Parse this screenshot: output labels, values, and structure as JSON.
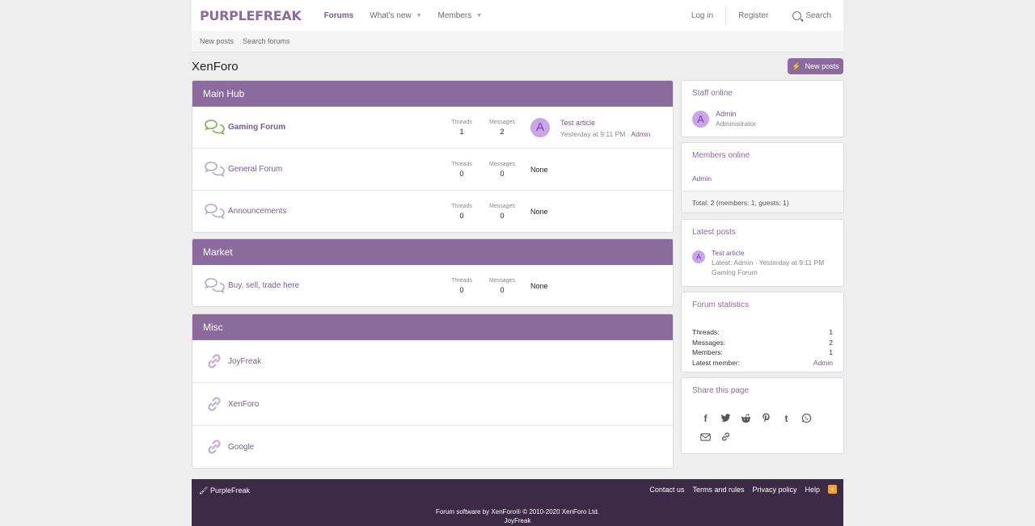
{
  "header": {
    "logo": "PURPLEFREAK",
    "nav": [
      {
        "label": "Forums",
        "active": true
      },
      {
        "label": "What's new",
        "caret": true
      },
      {
        "label": "Members",
        "caret": true
      }
    ],
    "login": "Log in",
    "register": "Register",
    "search": "Search"
  },
  "subnav": {
    "new_posts": "New posts",
    "search_forums": "Search forums"
  },
  "page": {
    "title": "XenForo",
    "new_posts_button": "New posts"
  },
  "categories": [
    {
      "title": "Main Hub",
      "nodes": [
        {
          "title": "Gaming Forum",
          "threads": "1",
          "messages": "2",
          "last_title": "Test article",
          "last_meta": "Yesterday at 9:11 PM · ",
          "last_user": "Admin",
          "avatar": "A"
        },
        {
          "title": "General Forum",
          "threads": "0",
          "messages": "0",
          "none": "None"
        },
        {
          "title": "Announcements",
          "threads": "0",
          "messages": "0",
          "none": "None"
        }
      ]
    },
    {
      "title": "Market",
      "nodes": [
        {
          "title": "Buy, sell, trade here",
          "threads": "0",
          "messages": "0",
          "none": "None"
        }
      ]
    },
    {
      "title": "Misc",
      "links": [
        "JoyFreak",
        "XenForo",
        "Google"
      ]
    }
  ],
  "labels": {
    "threads": "Threads",
    "messages": "Messages"
  },
  "sidebar": {
    "staff": {
      "title": "Staff online",
      "name": "Admin",
      "role": "Administrator",
      "avatar": "A"
    },
    "members": {
      "title": "Members online",
      "user": "Admin",
      "total": "Total: 2 (members: 1, guests: 1)"
    },
    "latest": {
      "title": "Latest posts",
      "post": "Test article",
      "meta": "Latest: Admin · Yesterday at 9:11 PM",
      "forum": "Gaming Forum",
      "avatar": "A"
    },
    "stats": {
      "title": "Forum statistics",
      "rows": [
        {
          "label": "Threads:",
          "value": "1"
        },
        {
          "label": "Messages:",
          "value": "2"
        },
        {
          "label": "Members:",
          "value": "1"
        },
        {
          "label": "Latest member:",
          "value": "Admin"
        }
      ]
    },
    "share": {
      "title": "Share this page"
    }
  },
  "footer": {
    "brand": "PurpleFreak",
    "links": [
      "Contact us",
      "Terms and rules",
      "Privacy policy",
      "Help"
    ],
    "copyright": "Forum software by XenForo® © 2010-2020 XenForo Ltd.",
    "style": "JoyFreak"
  },
  "colors": {
    "accent": "#8b6b9e",
    "footer": "#3d2a47",
    "link": "#7c5a91"
  }
}
